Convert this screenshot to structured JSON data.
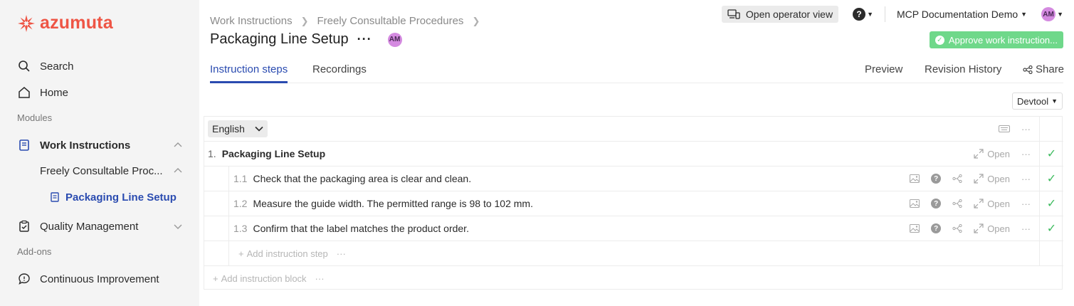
{
  "app": {
    "brand": "azumuta"
  },
  "sidebar": {
    "search": "Search",
    "home": "Home",
    "modules_label": "Modules",
    "work_instructions": "Work Instructions",
    "freely_consultable": "Freely Consultable Proc...",
    "packaging_line": "Packaging Line Setup",
    "quality_management": "Quality Management",
    "addons_label": "Add-ons",
    "continuous_improvement": "Continuous Improvement"
  },
  "header": {
    "breadcrumb": [
      "Work Instructions",
      "Freely Consultable Procedures"
    ],
    "title": "Packaging Line Setup",
    "title_more": "···",
    "avatar": "AM",
    "open_operator_view": "Open operator view",
    "help": "?",
    "org_name": "MCP Documentation Demo",
    "user_avatar": "AM",
    "approve": "Approve work instruction..."
  },
  "tabs": {
    "instruction_steps": "Instruction steps",
    "recordings": "Recordings",
    "preview": "Preview",
    "revision_history": "Revision History",
    "share": "Share"
  },
  "devtool": "Devtool",
  "grid": {
    "language": "English",
    "block": {
      "number": "1.",
      "title": "Packaging Line Setup",
      "open": "Open"
    },
    "steps": [
      {
        "number": "1.1",
        "text": "Check that the packaging area is clear and clean.",
        "open": "Open"
      },
      {
        "number": "1.2",
        "text": "Measure the guide width. The permitted range is 98 to 102 mm.",
        "open": "Open"
      },
      {
        "number": "1.3",
        "text": "Confirm that the label matches the product order.",
        "open": "Open"
      }
    ],
    "add_step": "Add instruction step",
    "add_block": "Add instruction block",
    "more": "···"
  },
  "colors": {
    "brand": "#ee5545",
    "accent": "#2a4bb0",
    "success": "#6fd88a",
    "check": "#3dbb5e"
  }
}
